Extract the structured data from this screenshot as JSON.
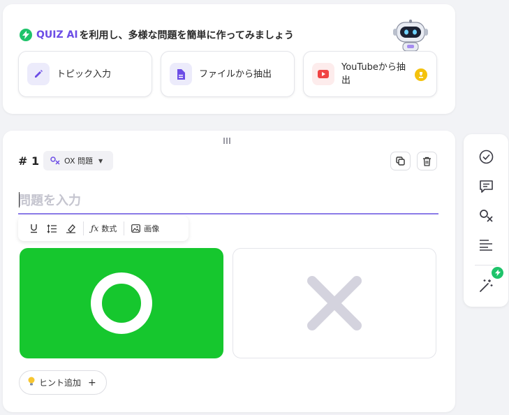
{
  "ai_panel": {
    "brand": "QUIZ AI",
    "headline_rest": "を利用し、多様な問題を簡単に作ってみましょう",
    "options": [
      {
        "label": "トピック入力",
        "icon": "pencil-icon"
      },
      {
        "label": "ファイルから抽出",
        "icon": "document-icon"
      },
      {
        "label": "YouTubeから抽出",
        "icon": "youtube-icon",
        "premium_icon": "crown-icon"
      }
    ]
  },
  "question": {
    "number": "# 1",
    "type_label": "OX 問題",
    "input_value": "",
    "input_placeholder": "問題を入力",
    "toolbar": {
      "formula_label": "数式",
      "image_label": "画像"
    },
    "answers": [
      {
        "symbol": "O",
        "selected": true,
        "color": "#16c72e"
      },
      {
        "symbol": "X",
        "selected": false,
        "color": "#d4d3de"
      }
    ],
    "hint_label": "ヒント追加",
    "hint_plus": "+"
  },
  "colors": {
    "accent": "#6c4de6",
    "green": "#1ec36a",
    "input_underline": "#8b7be8",
    "premium": "#f4c20d"
  },
  "sidebar_icons": [
    "check-circle-icon",
    "comment-icon",
    "ox-icon",
    "align-left-icon",
    "magic-wand-icon"
  ]
}
